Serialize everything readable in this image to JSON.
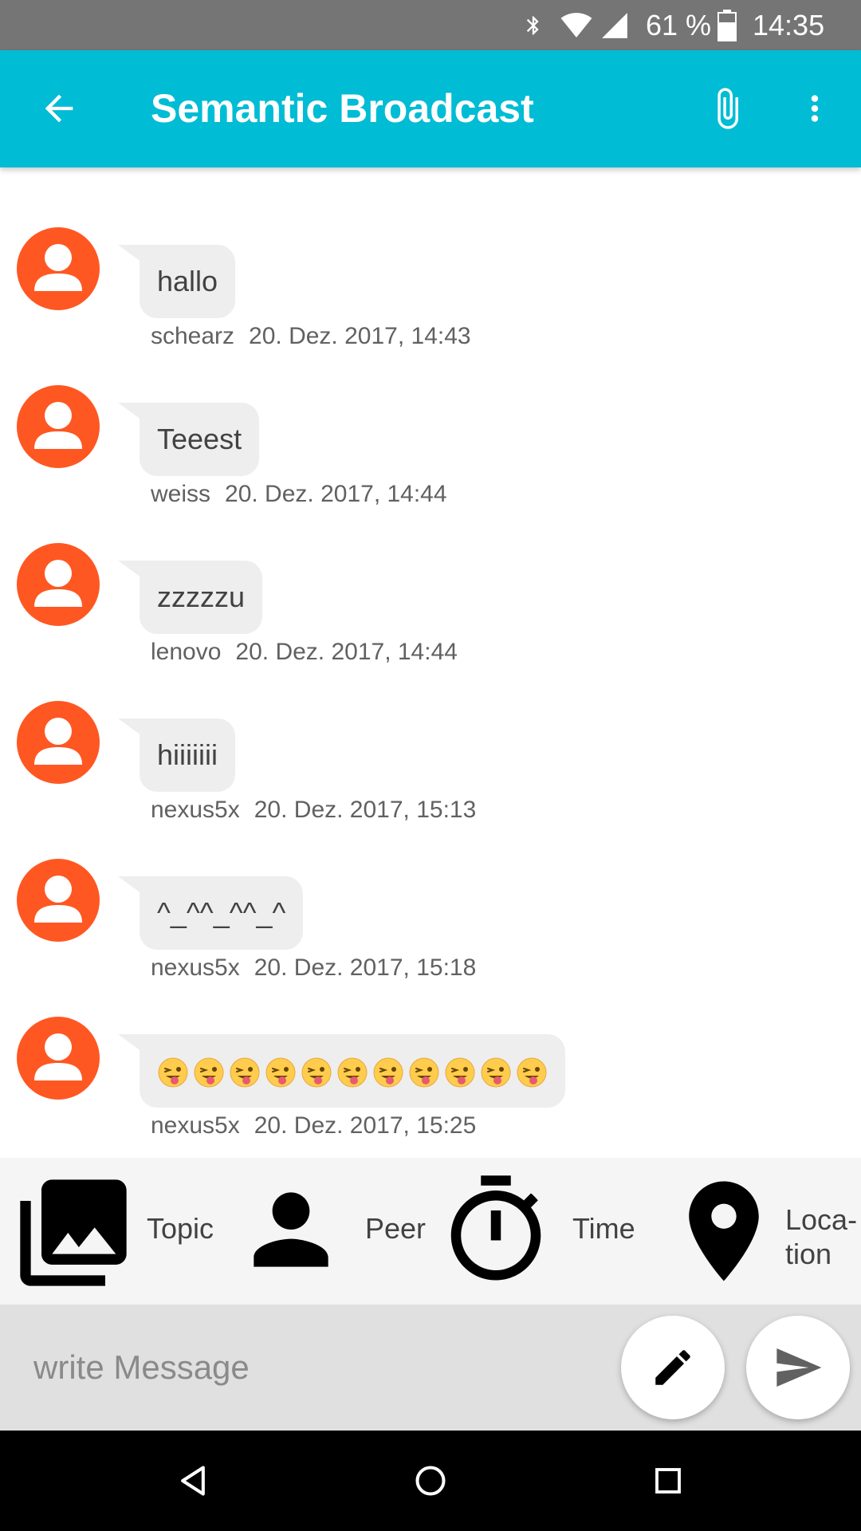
{
  "status_bar": {
    "battery_percent": "61 %",
    "time": "14:35",
    "icons": [
      "bluetooth-icon",
      "wifi-icon",
      "cell-signal-icon",
      "battery-icon"
    ]
  },
  "app_bar": {
    "title": "Semantic Broadcast",
    "back_icon": "arrow-back-icon",
    "attach_icon": "paperclip-icon",
    "menu_icon": "more-vert-icon",
    "color": "#00BCD4"
  },
  "messages": [
    {
      "text": "hallo",
      "sender": "schearz",
      "time": "20. Dez. 2017, 14:43"
    },
    {
      "text": "Teeest",
      "sender": "weiss",
      "time": "20. Dez. 2017, 14:44"
    },
    {
      "text": "zzzzzu",
      "sender": "lenovo",
      "time": "20. Dez. 2017, 14:44"
    },
    {
      "text": "hiiiiiii",
      "sender": "nexus5x",
      "time": "20. Dez. 2017, 15:13"
    },
    {
      "text": "^_^^_^^_^",
      "sender": "nexus5x",
      "time": "20. Dez. 2017, 15:18"
    },
    {
      "text": "😜😜😜😜😜😜😜😜😜😜😜",
      "sender": "nexus5x",
      "time": "20. Dez. 2017, 15:25"
    }
  ],
  "avatar_color": "#FF5722",
  "filters": {
    "topic": "Topic",
    "peer": "Peer",
    "time": "Time",
    "location_line1": "Loca-",
    "location_line2": "tion"
  },
  "input": {
    "placeholder": "write Message",
    "edit_icon": "pencil-icon",
    "send_icon": "send-icon"
  },
  "nav_bar": {
    "back": "nav-back-icon",
    "home": "nav-home-icon",
    "recents": "nav-recents-icon"
  }
}
